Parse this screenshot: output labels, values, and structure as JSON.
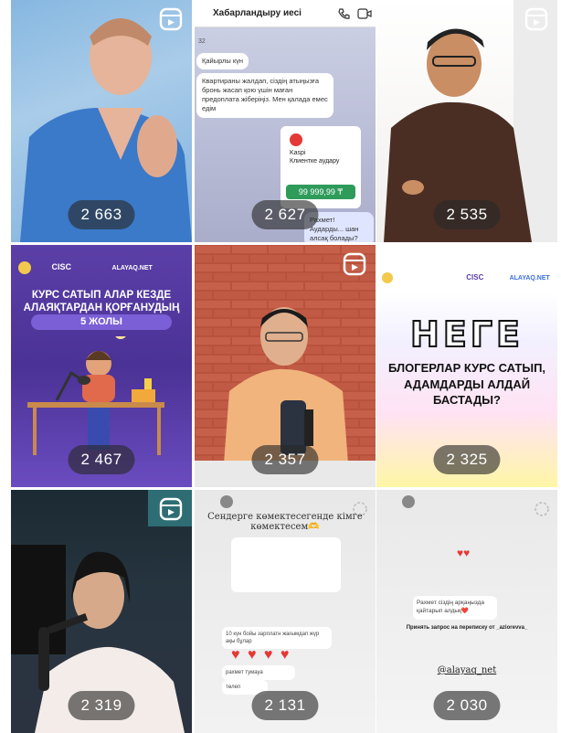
{
  "posts": [
    {
      "count": "2 663",
      "type": "reel"
    },
    {
      "count": "2 627",
      "type": "reel"
    },
    {
      "count": "2 535",
      "type": "reel"
    },
    {
      "count": "2 467",
      "type": "post"
    },
    {
      "count": "2 357",
      "type": "reel"
    },
    {
      "count": "2 325",
      "type": "post"
    },
    {
      "count": "2 319",
      "type": "reel"
    },
    {
      "count": "2 131",
      "type": "post"
    },
    {
      "count": "2 030",
      "type": "post"
    }
  ],
  "tile2": {
    "chat_name": "Хабарландыру иесі",
    "msg_number": "32",
    "msg1": "Қайырлы күн",
    "msg2": "Квартираны жалдап, сіздің атыңызға бронь жасап қою үшін маған предоплата жіберіңіз. Мен қалада емес едім",
    "card_title": "Kaspi",
    "card_sub": "Клиентке аудару",
    "amount": "99 999,99 ₸",
    "msg3": "Рахмет! Аударды... шан алсақ болады?"
  },
  "tile4": {
    "logos": "CISC",
    "logo2": "ALAYAQ.NET",
    "title_line1": "КУРС САТЫП АЛАР КЕЗДЕ",
    "title_line2": "АЛАЯҚТАРДАН ҚОРҒАНУДЫҢ",
    "pill": "5 ЖОЛЫ"
  },
  "tile6": {
    "logos": "CISC",
    "logo2": "ALAYAQ.NET",
    "big": "НЕГЕ",
    "sub": "БЛОГЕРЛАР КУРС САТЫП, АДАМДАРДЫ АЛДАЙ БАСТАДЫ?"
  },
  "tile8": {
    "title": "Сендерге көмектесегенде кімге көмектесем🫶",
    "line1": "10 күн бойы зарплатн жағымдап жүр ақы бұлар",
    "line2": "рахмет тумауа",
    "line3": "төлеп"
  },
  "tile9": {
    "msg1": "Рахмет сіздің арқаңызда қайтарып алдық❤️",
    "msg2": "Принять запрос на переписку от _aziorevva_",
    "handle": "@alayaq_net"
  },
  "colors": {
    "count_bg": "#282828",
    "accent_purple": "#5b3fa8",
    "heart_red": "#e53935"
  }
}
